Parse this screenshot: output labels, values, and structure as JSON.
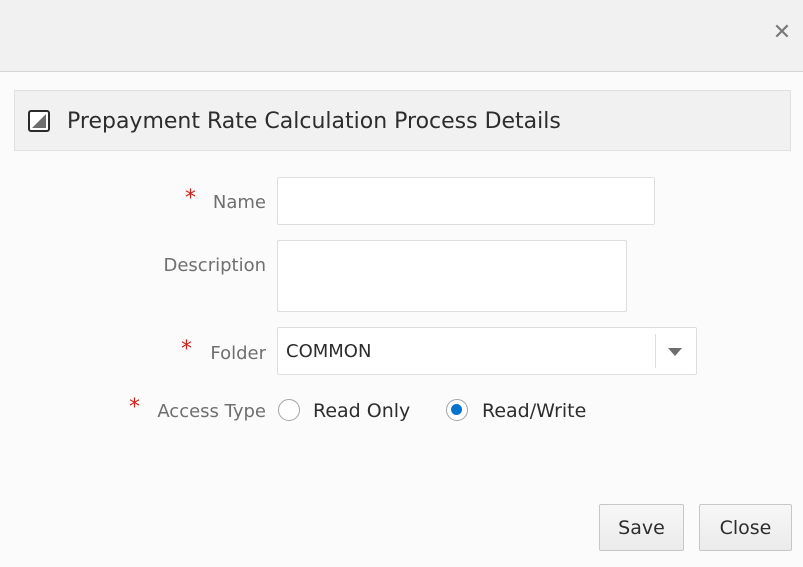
{
  "dialog": {
    "close_glyph": "✕"
  },
  "section": {
    "title": "Prepayment Rate Calculation Process Details"
  },
  "form": {
    "required_marker": "*",
    "name": {
      "label": "Name",
      "value": ""
    },
    "description": {
      "label": "Description",
      "value": ""
    },
    "folder": {
      "label": "Folder",
      "value": "COMMON"
    },
    "access_type": {
      "label": "Access Type",
      "options": [
        {
          "label": "Read Only",
          "selected": false
        },
        {
          "label": "Read/Write",
          "selected": true
        }
      ]
    }
  },
  "buttons": {
    "save": "Save",
    "close": "Close"
  },
  "colors": {
    "accent": "#0572ce",
    "required": "#d0231c"
  }
}
